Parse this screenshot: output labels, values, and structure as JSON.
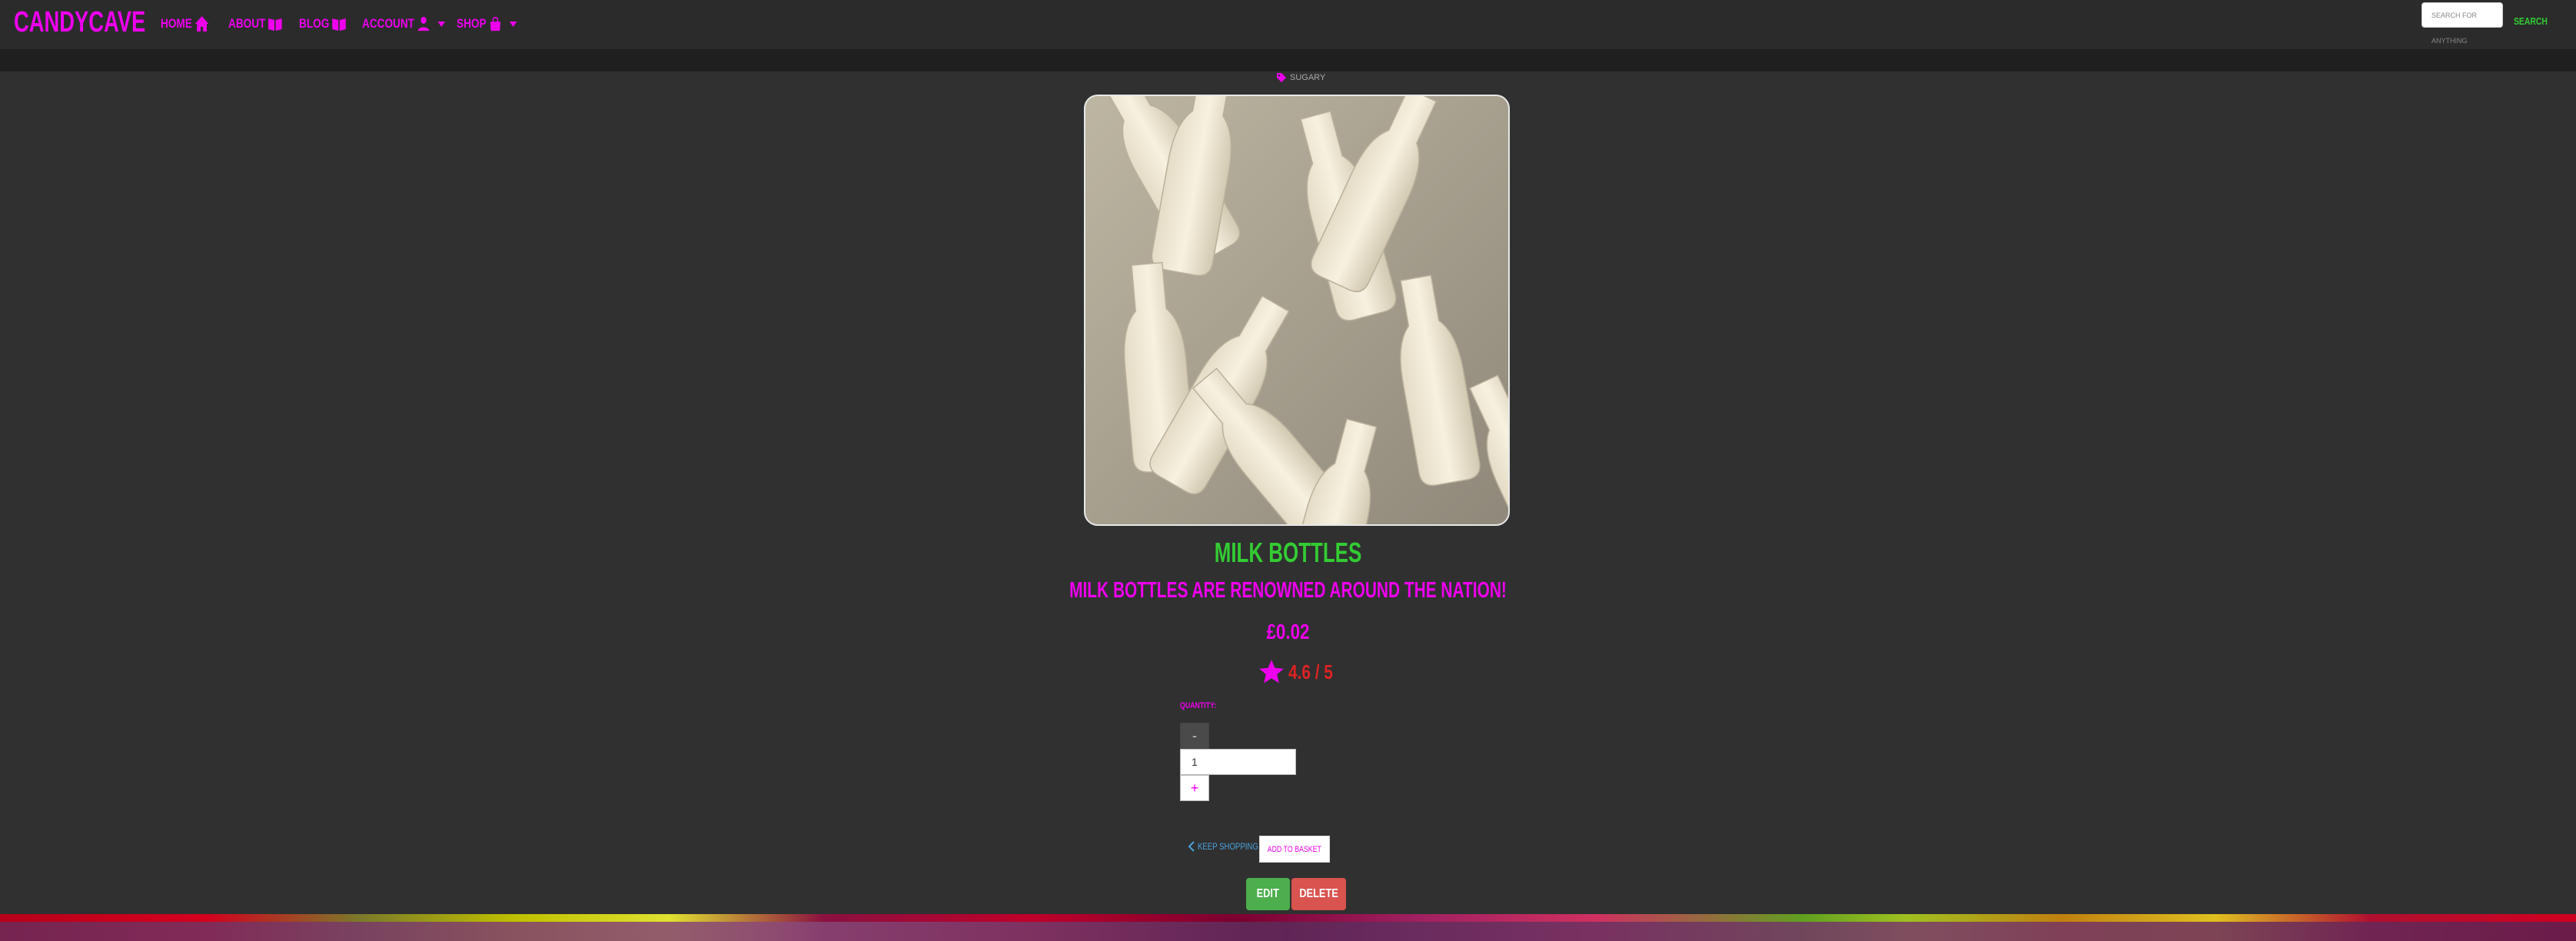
{
  "navbar": {
    "brand": "CANDYCAVE",
    "links": [
      {
        "label": "HOME",
        "icon": "home-icon",
        "dropdown": false
      },
      {
        "label": "ABOUT",
        "icon": "book-open-icon",
        "dropdown": false
      },
      {
        "label": "BLOG",
        "icon": "book-open-icon",
        "dropdown": false
      },
      {
        "label": "ACCOUNT",
        "icon": "user-icon",
        "dropdown": true
      },
      {
        "label": "SHOP",
        "icon": "shopping-bag-icon",
        "dropdown": true
      }
    ],
    "search": {
      "placeholder": "SEARCH FOR ANYTHING",
      "button_label": "SEARCH"
    }
  },
  "product": {
    "category": "SUGARY",
    "name": "MILK BOTTLES",
    "description": "MILK BOTTLES ARE RENOWNED AROUND THE NATION!",
    "price": "£0.02",
    "rating": "4.6 / 5",
    "quantity_label": "QUANTITY:",
    "quantity_value": "1",
    "minus_label": "-",
    "plus_label": "+"
  },
  "actions": {
    "keep_shopping": "KEEP SHOPPING",
    "add_to_basket": "ADD TO BASKET",
    "edit": "EDIT",
    "delete": "DELETE"
  },
  "colors": {
    "accent": "#ee00ee",
    "name_green": "#33cc33",
    "rating_red": "#dd2222",
    "edit_green": "#4cae4c",
    "delete_red": "#d9534f",
    "background": "#303030"
  }
}
